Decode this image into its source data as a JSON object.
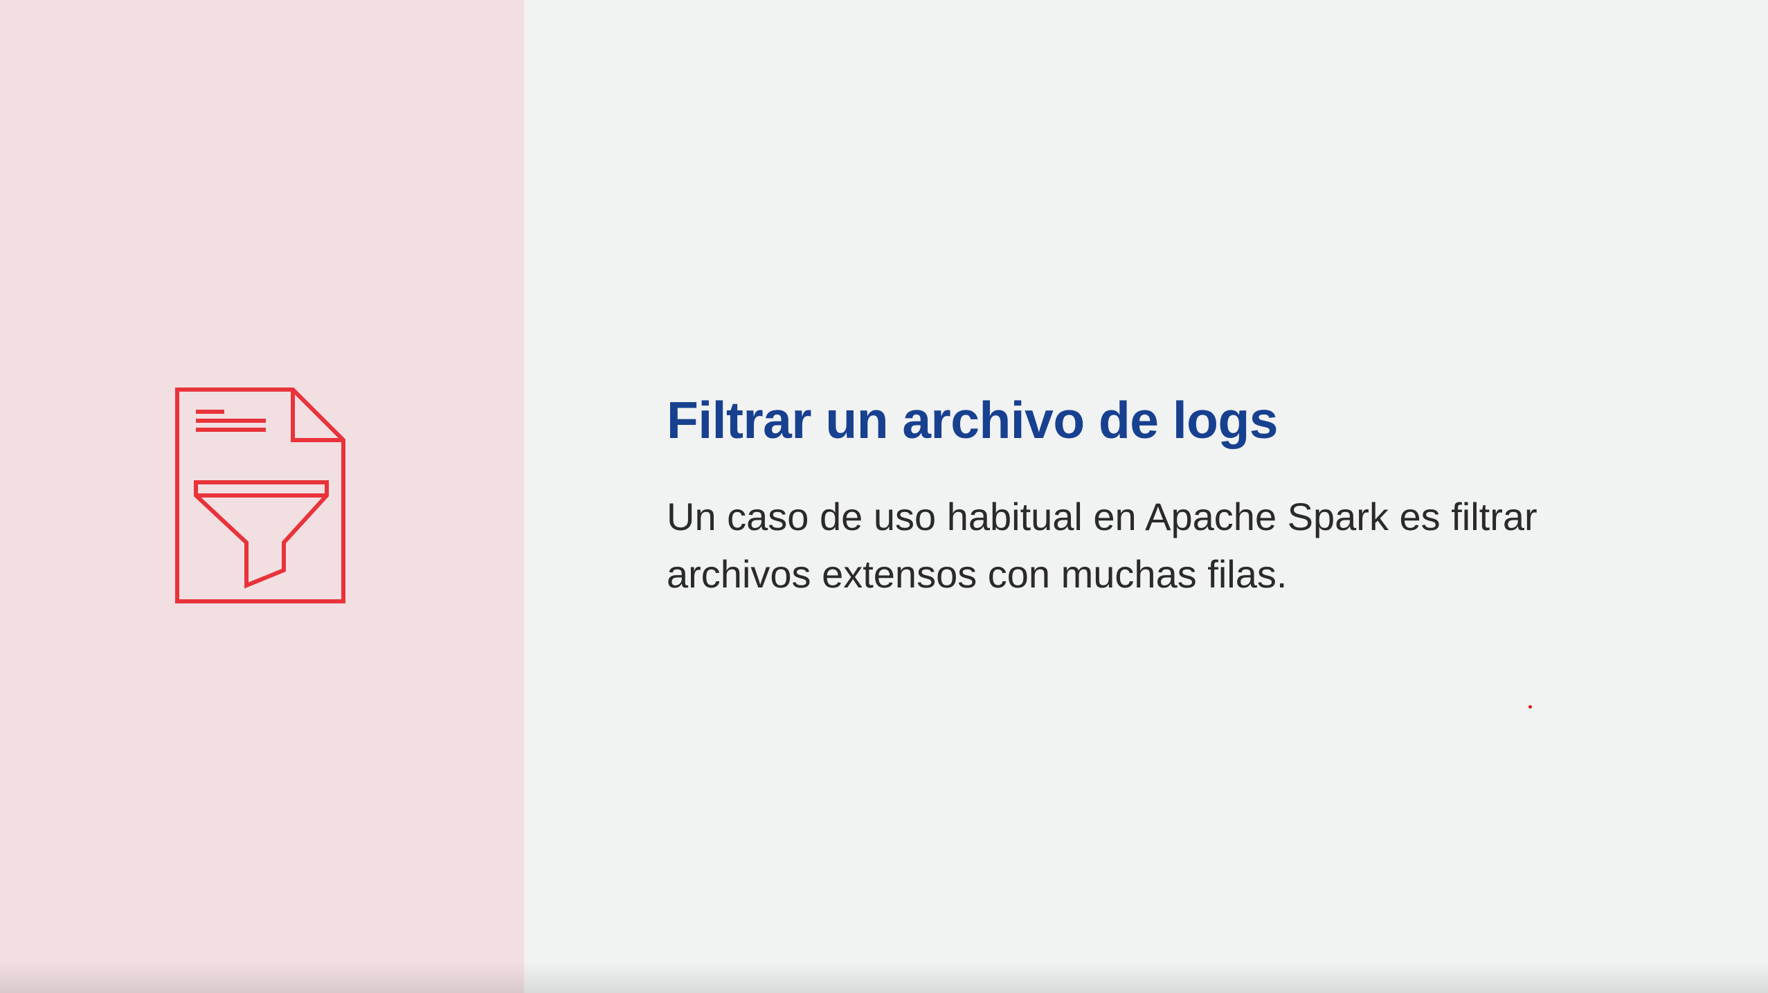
{
  "slide": {
    "title": "Filtrar un archivo de logs",
    "body_line_1": "Un caso de uso habitual en Apache Spark es filtrar",
    "body_line_2": "archivos extensos con muchas filas."
  },
  "icon": {
    "name": "document-filter-icon",
    "color": "#e8333a"
  },
  "colors": {
    "left_panel": "#f2dfe2",
    "background": "#f1f2f2",
    "title": "#17408f",
    "body_text": "#2a2a2a",
    "pointer": "#e0161a"
  }
}
